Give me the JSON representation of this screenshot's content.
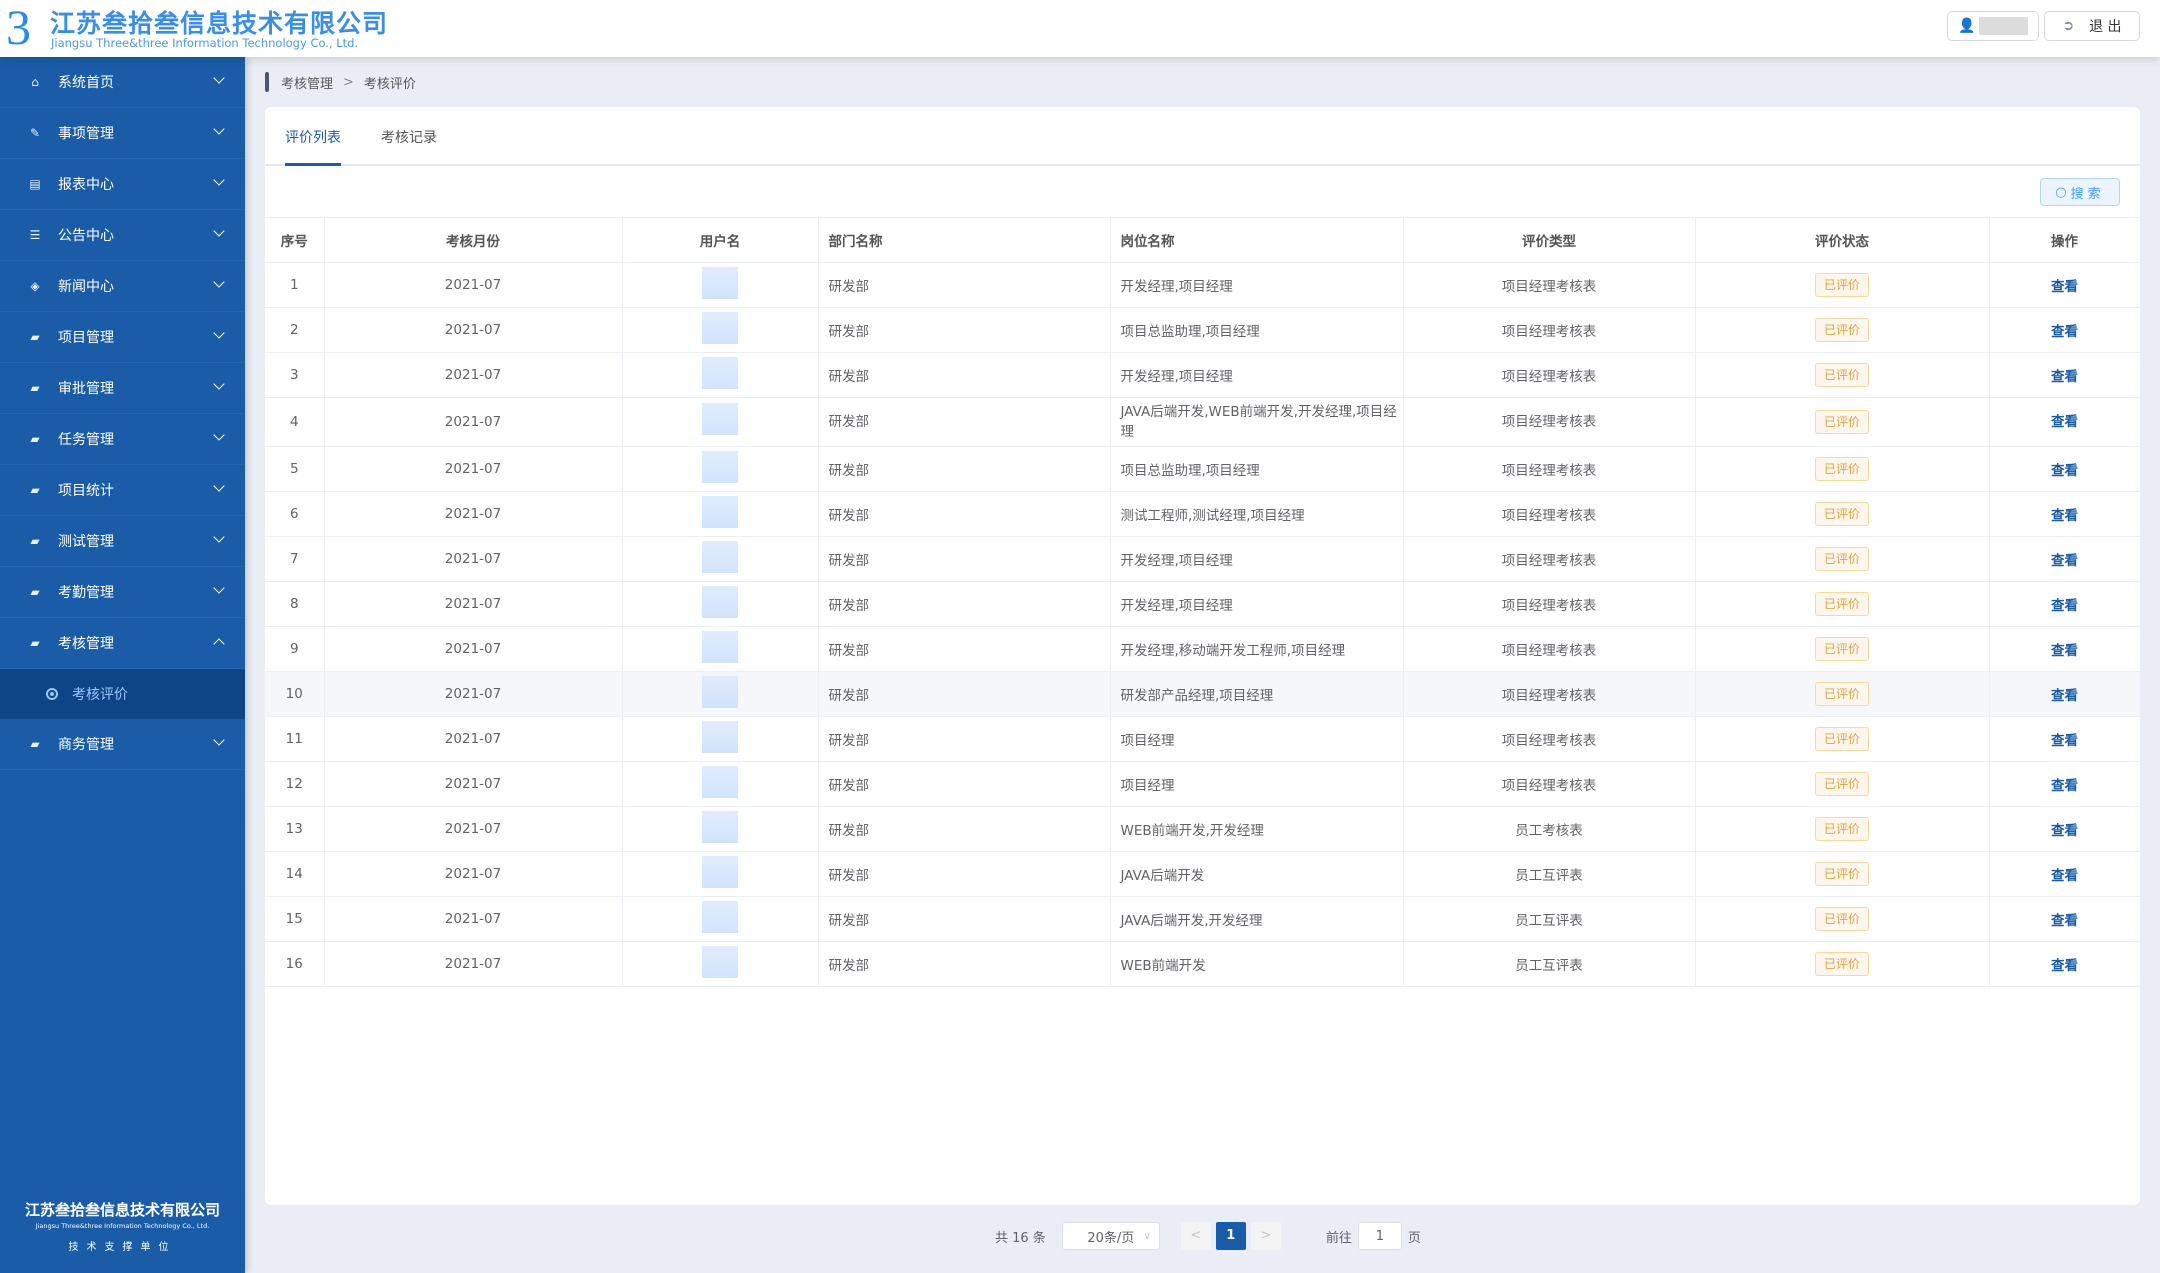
{
  "header": {
    "company_cn": "江苏叁拾叁信息技术有限公司",
    "company_en": "Jiangsu Three&three Information Technology Co., Ltd.",
    "logout": "退 出"
  },
  "sidebar": {
    "items": [
      {
        "label": "系统首页",
        "icon": "home-icon"
      },
      {
        "label": "事项管理",
        "icon": "document-edit-icon"
      },
      {
        "label": "报表中心",
        "icon": "report-icon"
      },
      {
        "label": "公告中心",
        "icon": "list-icon"
      },
      {
        "label": "新闻中心",
        "icon": "layers-icon"
      },
      {
        "label": "项目管理",
        "icon": "folder-icon"
      },
      {
        "label": "审批管理",
        "icon": "folder-icon"
      },
      {
        "label": "任务管理",
        "icon": "folder-icon"
      },
      {
        "label": "项目统计",
        "icon": "folder-icon"
      },
      {
        "label": "测试管理",
        "icon": "folder-icon"
      },
      {
        "label": "考勤管理",
        "icon": "folder-icon"
      },
      {
        "label": "考核管理",
        "icon": "folder-icon",
        "expanded": true
      },
      {
        "label": "商务管理",
        "icon": "folder-icon"
      }
    ],
    "sub_active": "考核评价",
    "footer": {
      "cn": "江苏叁拾叁信息技术有限公司",
      "en": "Jiangsu Three&three Information Technology Co., Ltd.",
      "support": "技术支撑单位"
    }
  },
  "breadcrumb": [
    "考核管理",
    "考核评价"
  ],
  "tabs": [
    {
      "label": "评价列表",
      "active": true
    },
    {
      "label": "考核记录"
    }
  ],
  "search_label": "搜索",
  "table": {
    "columns": [
      "序号",
      "考核月份",
      "用户名",
      "部门名称",
      "岗位名称",
      "评价类型",
      "评价状态",
      "操作"
    ],
    "rows": [
      [
        "1",
        "2021-07",
        "研发部",
        "开发经理,项目经理",
        "项目经理考核表"
      ],
      [
        "2",
        "2021-07",
        "研发部",
        "项目总监助理,项目经理",
        "项目经理考核表"
      ],
      [
        "3",
        "2021-07",
        "研发部",
        "开发经理,项目经理",
        "项目经理考核表"
      ],
      [
        "4",
        "2021-07",
        "研发部",
        "JAVA后端开发,WEB前端开发,开发经理,项目经理",
        "项目经理考核表"
      ],
      [
        "5",
        "2021-07",
        "研发部",
        "项目总监助理,项目经理",
        "项目经理考核表"
      ],
      [
        "6",
        "2021-07",
        "研发部",
        "测试工程师,测试经理,项目经理",
        "项目经理考核表"
      ],
      [
        "7",
        "2021-07",
        "研发部",
        "开发经理,项目经理",
        "项目经理考核表"
      ],
      [
        "8",
        "2021-07",
        "研发部",
        "开发经理,项目经理",
        "项目经理考核表"
      ],
      [
        "9",
        "2021-07",
        "研发部",
        "开发经理,移动端开发工程师,项目经理",
        "项目经理考核表"
      ],
      [
        "10",
        "2021-07",
        "研发部",
        "研发部产品经理,项目经理",
        "项目经理考核表"
      ],
      [
        "11",
        "2021-07",
        "研发部",
        "项目经理",
        "项目经理考核表"
      ],
      [
        "12",
        "2021-07",
        "研发部",
        "项目经理",
        "项目经理考核表"
      ],
      [
        "13",
        "2021-07",
        "研发部",
        "WEB前端开发,开发经理",
        "员工考核表"
      ],
      [
        "14",
        "2021-07",
        "研发部",
        "JAVA后端开发",
        "员工互评表"
      ],
      [
        "15",
        "2021-07",
        "研发部",
        "JAVA后端开发,开发经理",
        "员工互评表"
      ],
      [
        "16",
        "2021-07",
        "研发部",
        "WEB前端开发",
        "员工互评表"
      ]
    ],
    "status": "已评价",
    "action": "查看"
  },
  "pagination": {
    "total": "共 16 条",
    "page_size": "20条/页",
    "current": "1",
    "goto_label": "前往",
    "goto_value": "1",
    "page_suffix": "页"
  },
  "colors": {
    "sidebar": "#1a5ca8",
    "accent": "#1a5ca8",
    "badge": "#e6a23c"
  }
}
